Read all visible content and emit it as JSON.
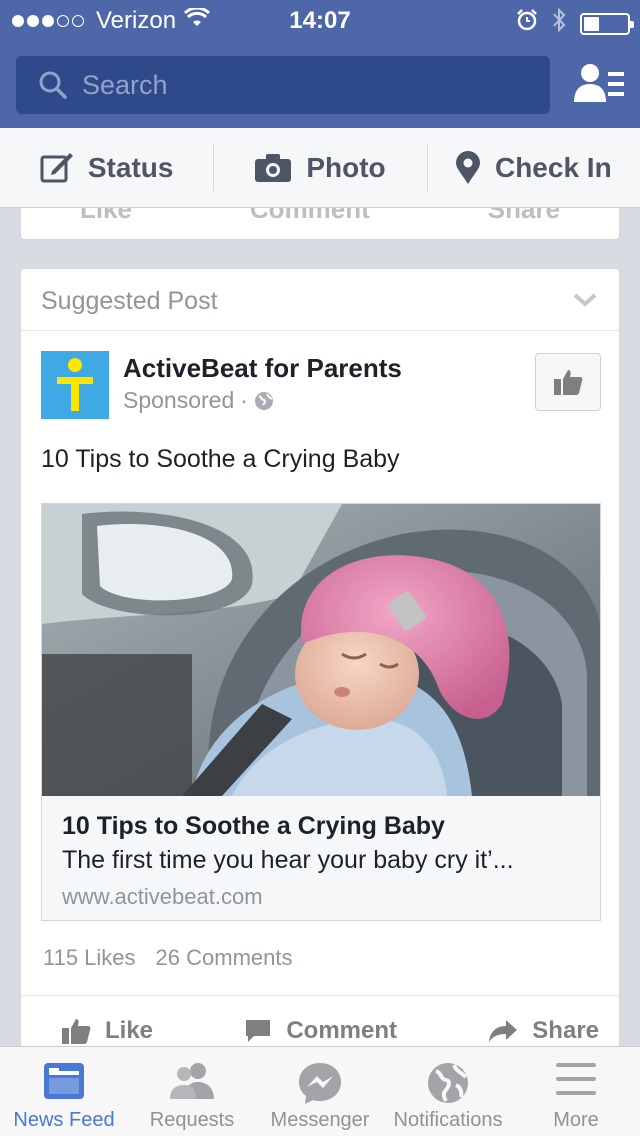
{
  "status_bar": {
    "carrier": "Verizon",
    "time": "14:07",
    "battery_level": 0.35
  },
  "search": {
    "placeholder": "Search"
  },
  "composer": {
    "status_label": "Status",
    "photo_label": "Photo",
    "checkin_label": "Check In"
  },
  "prev_card": {
    "like": "Like",
    "comment": "Comment",
    "share": "Share"
  },
  "post": {
    "header_label": "Suggested Post",
    "page_name": "ActiveBeat for Parents",
    "sponsored": "Sponsored",
    "separator": "·",
    "text": "10 Tips to Soothe a Crying Baby",
    "link": {
      "title": "10 Tips to Soothe a Crying Baby",
      "description": "The first time you hear your baby cry it’...",
      "url": "www.activebeat.com"
    },
    "likes": "115 Likes",
    "comments": "26 Comments",
    "actions": {
      "like": "Like",
      "comment": "Comment",
      "share": "Share"
    }
  },
  "tabs": [
    {
      "label": "News Feed",
      "icon": "news-feed-icon",
      "active": true
    },
    {
      "label": "Requests",
      "icon": "friend-requests-icon"
    },
    {
      "label": "Messenger",
      "icon": "messenger-icon"
    },
    {
      "label": "Notifications",
      "icon": "globe-icon"
    },
    {
      "label": "More",
      "icon": "menu-icon"
    }
  ],
  "colors": {
    "header_blue": "#4d67a8",
    "search_bg": "#2f4a8a",
    "active_tab": "#4a78d6",
    "page_logo_bg": "#3fa9e6",
    "page_logo_fg": "#ffe600"
  }
}
